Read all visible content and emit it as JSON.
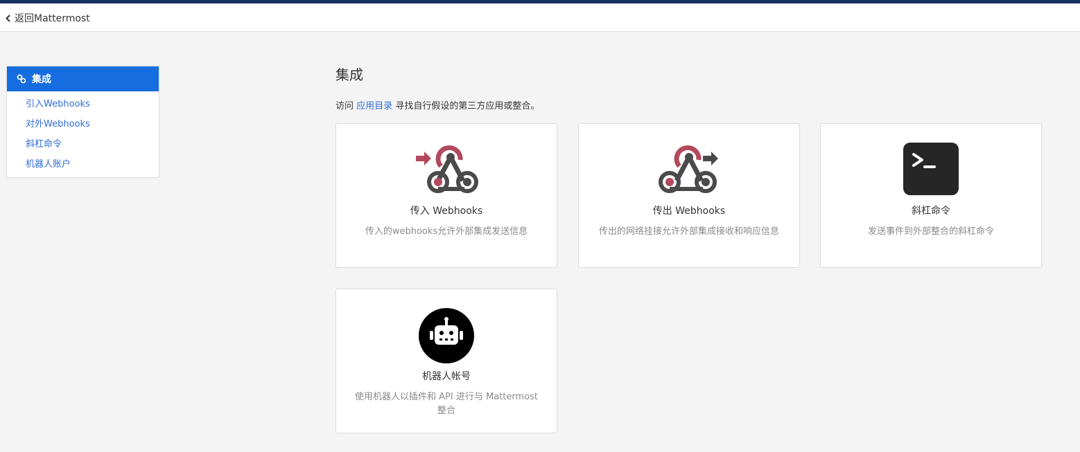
{
  "header": {
    "back_label": "返回Mattermost"
  },
  "sidebar": {
    "section_title": "集成",
    "items": [
      {
        "label": "引入Webhooks"
      },
      {
        "label": "对外Webhooks"
      },
      {
        "label": "斜杠命令"
      },
      {
        "label": "机器人账户"
      }
    ]
  },
  "main": {
    "title": "集成",
    "intro_prefix": "访问",
    "intro_link": "应用目录",
    "intro_suffix": "寻找自行假设的第三方应用或整合。",
    "cards": [
      {
        "title": "传入 Webhooks",
        "description": "传入的webhooks允许外部集成发送信息",
        "icon": "incoming-webhook-icon"
      },
      {
        "title": "传出 Webhooks",
        "description": "传出的网络挂接允许外部集成接收和响应信息",
        "icon": "outgoing-webhook-icon"
      },
      {
        "title": "斜杠命令",
        "description": "发送事件到外部整合的斜杠命令",
        "icon": "terminal-icon"
      },
      {
        "title": "机器人帐号",
        "description": "使用机器人以插件和 API 进行与 Mattermost 整合",
        "icon": "robot-icon"
      }
    ]
  },
  "colors": {
    "accent": "#166de0",
    "link": "#2f6bd3",
    "topbar": "#13305e",
    "webhook_red": "#b3495e",
    "webhook_gray": "#4a4a4a"
  }
}
